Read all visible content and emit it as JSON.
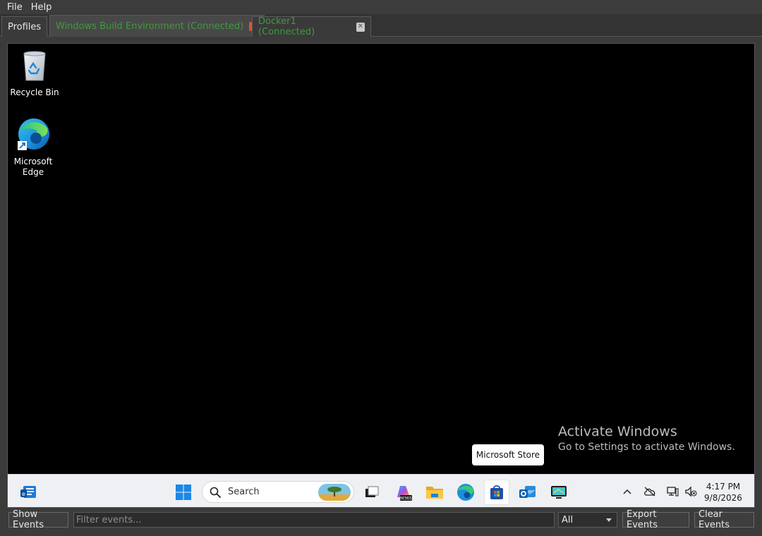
{
  "menu": {
    "file": "File",
    "help": "Help"
  },
  "tabs": [
    {
      "label": "Profiles"
    },
    {
      "label": "Windows Build Environment (Connected)",
      "close": "✕"
    },
    {
      "label": "Docker1 (Connected)",
      "close": "✕"
    }
  ],
  "desktop": {
    "icons": [
      {
        "label": "Recycle Bin",
        "icon": "recycle-bin-icon"
      },
      {
        "label": "Microsoft\nEdge",
        "label_line1": "Microsoft",
        "label_line2": "Edge",
        "icon": "edge-icon"
      }
    ],
    "watermark": {
      "title": "Activate Windows",
      "subtitle": "Go to Settings to activate Windows."
    },
    "tooltip": "Microsoft Store"
  },
  "taskbar": {
    "search_placeholder": "Search",
    "clock_time": "4:17 PM",
    "clock_date": "9/8/2026"
  },
  "eventbar": {
    "show_events": "Show Events",
    "filter_placeholder": "Filter events...",
    "filter_select": "All",
    "export_events": "Export Events",
    "clear_events": "Clear Events"
  },
  "colors": {
    "connected_green": "#3f9a3f",
    "close_red": "#d9533a"
  }
}
